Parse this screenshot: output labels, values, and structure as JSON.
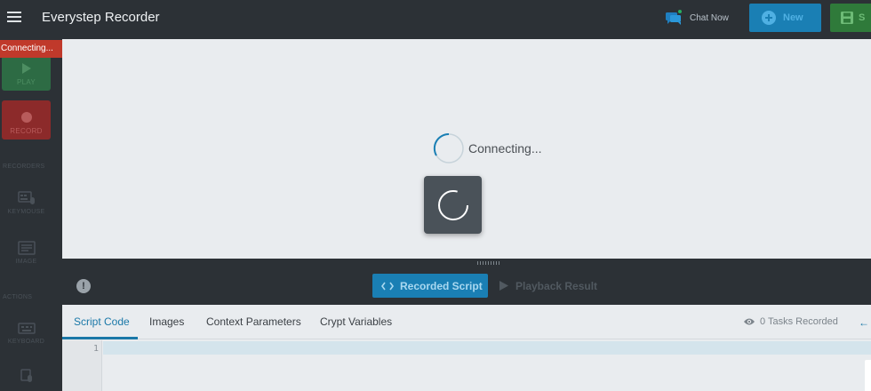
{
  "header": {
    "title": "Everystep Recorder",
    "chat_label": "Chat Now",
    "new_label": "New",
    "save_label": "S"
  },
  "sidebar": {
    "status_badge": "Connecting...",
    "play_label": "PLAY",
    "record_label": "RECORD",
    "section_1": "RECORDERS",
    "item_1": "KEYMOUSE",
    "item_2": "IMAGE",
    "section_2": "ACTIONS",
    "item_3": "KEYBOARD"
  },
  "main": {
    "status_text": "Connecting..."
  },
  "bottom": {
    "recorded_script_label": "Recorded Script",
    "playback_result_label": "Playback Result",
    "tabs": [
      "Script Code",
      "Images",
      "Context Parameters",
      "Crypt Variables"
    ],
    "tasks_recorded": "0 Tasks Recorded",
    "line_number": "1"
  },
  "colors": {
    "dark_bg": "#2c3136",
    "accent_blue": "#1a7fb4",
    "play_green": "#2d6b44",
    "record_red": "#8c2a2a",
    "status_red": "#c0392b"
  }
}
